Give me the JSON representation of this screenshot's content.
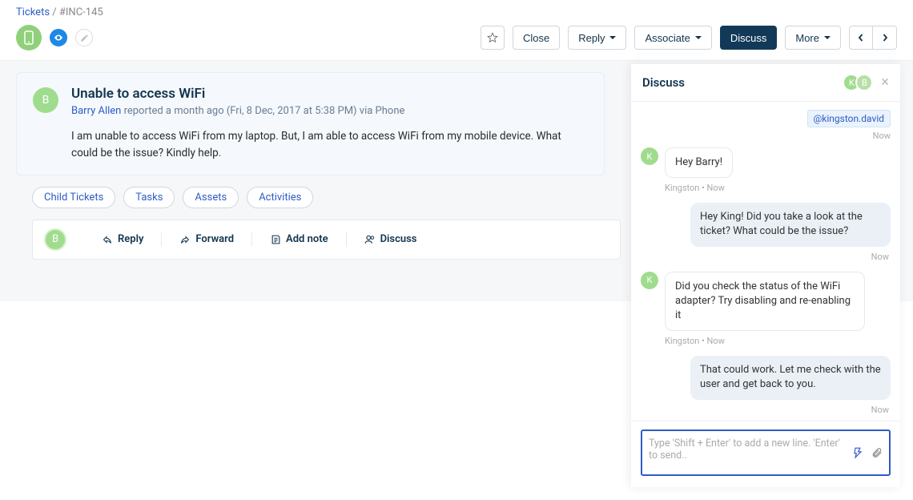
{
  "breadcrumb": {
    "root": "Tickets",
    "sep": "/",
    "id": "#INC-145"
  },
  "toolbar": {
    "close": "Close",
    "reply": "Reply",
    "associate": "Associate",
    "discuss": "Discuss",
    "more": "More"
  },
  "ticket": {
    "avatar_letter": "B",
    "title": "Unable to access WiFi",
    "reporter": "Barry Allen",
    "reported_text": " reported a month ago (Fri, 8 Dec, 2017 at 5:38 PM) via Phone",
    "body": "I am unable to access WiFi from my laptop. But, I am able to access WiFi from my mobile device. What could be the issue? Kindly help."
  },
  "chips": [
    "Child Tickets",
    "Tasks",
    "Assets",
    "Activities"
  ],
  "actions": {
    "avatar_letter": "B",
    "reply": "Reply",
    "forward": "Forward",
    "addnote": "Add note",
    "discuss": "Discuss"
  },
  "panel": {
    "title": "Discuss",
    "mention": "@kingston.david",
    "now": "Now",
    "avatars": [
      "K",
      "B"
    ],
    "messages": [
      {
        "side": "left",
        "avatar": "K",
        "text": "Hey Barry!",
        "meta": "Kingston  •  Now"
      },
      {
        "side": "right",
        "text": "Hey King! Did you take a look at the ticket? What could be the issue?",
        "meta": "Now"
      },
      {
        "side": "left",
        "avatar": "K",
        "text": "Did you check the status of the WiFi adapter? Try disabling and re-enabling it",
        "meta": "Kingston  •  Now"
      },
      {
        "side": "right",
        "text": "That could work. Let me check with the user and get back to you.",
        "meta": "Now"
      }
    ],
    "input_placeholder": "Type 'Shift + Enter' to add a new line. 'Enter' to send.."
  }
}
